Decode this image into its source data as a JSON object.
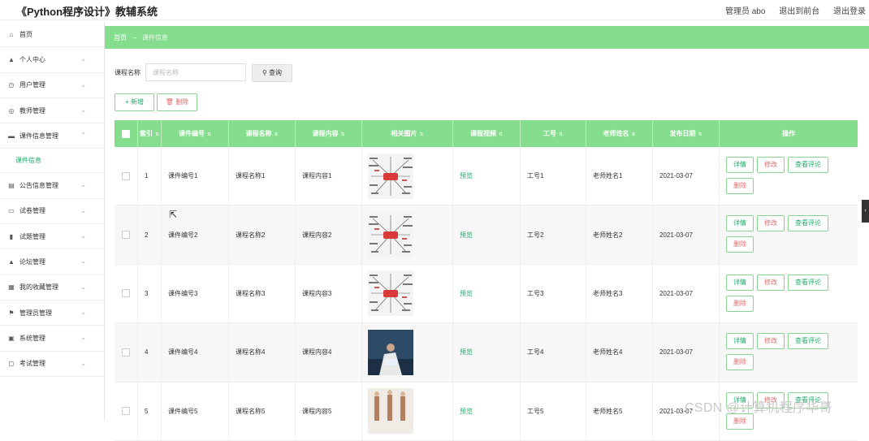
{
  "app": {
    "title": "《Python程序设计》教辅系统",
    "user_label": "管理员 abo",
    "front_link": "退出到前台",
    "logout_link": "退出登录"
  },
  "sidebar": {
    "items": [
      {
        "label": "首页",
        "icon": "home-icon"
      },
      {
        "label": "个人中心",
        "icon": "user-icon"
      },
      {
        "label": "用户管理",
        "icon": "clock-icon"
      },
      {
        "label": "教师管理",
        "icon": "circle-icon"
      },
      {
        "label": "课件信息管理",
        "icon": "folder-icon",
        "expanded": true,
        "sub": "课件信息"
      },
      {
        "label": "公告信息管理",
        "icon": "board-icon"
      },
      {
        "label": "试卷管理",
        "icon": "paper-icon"
      },
      {
        "label": "试题管理",
        "icon": "bar-chart-icon"
      },
      {
        "label": "论坛管理",
        "icon": "forum-icon"
      },
      {
        "label": "我的收藏管理",
        "icon": "grid-icon"
      },
      {
        "label": "管理员管理",
        "icon": "flag-icon"
      },
      {
        "label": "系统管理",
        "icon": "system-icon"
      },
      {
        "label": "考试管理",
        "icon": "exam-icon"
      }
    ]
  },
  "breadcrumb": {
    "home": "首页",
    "arrow": "→",
    "current": "课件信息"
  },
  "search": {
    "label": "课程名称",
    "placeholder": "课程名称",
    "button": "查询"
  },
  "toolbar": {
    "add": "新增",
    "delete": "删除"
  },
  "table": {
    "columns": [
      "索引",
      "课件编号",
      "课程名称",
      "课程内容",
      "相关图片",
      "课程视频",
      "工号",
      "老师姓名",
      "发布日期",
      "操作"
    ],
    "rows": [
      {
        "idx": "1",
        "code": "课件编号1",
        "name": "课程名称1",
        "content": "课程内容1",
        "video": "预览",
        "job": "工号1",
        "teacher": "老师姓名1",
        "date": "2021-03-07",
        "img": "mindmap"
      },
      {
        "idx": "2",
        "code": "课件编号2",
        "name": "课程名称2",
        "content": "课程内容2",
        "video": "预览",
        "job": "工号2",
        "teacher": "老师姓名2",
        "date": "2021-03-07",
        "img": "mindmap"
      },
      {
        "idx": "3",
        "code": "课件编号3",
        "name": "课程名称3",
        "content": "课程内容3",
        "video": "预览",
        "job": "工号3",
        "teacher": "老师姓名3",
        "date": "2021-03-07",
        "img": "mindmap"
      },
      {
        "idx": "4",
        "code": "课件编号4",
        "name": "课程名称4",
        "content": "课程内容4",
        "video": "预览",
        "job": "工号4",
        "teacher": "老师姓名4",
        "date": "2021-03-07",
        "img": "business"
      },
      {
        "idx": "5",
        "code": "课件编号5",
        "name": "课程名称5",
        "content": "课程内容5",
        "video": "预览",
        "job": "工号5",
        "teacher": "老师姓名5",
        "date": "2021-03-07",
        "img": "people"
      }
    ],
    "actions": {
      "detail": "详情",
      "edit": "修改",
      "comment": "查看评论",
      "delete": "删除"
    }
  },
  "watermark": "CSDN @计算机程序华哥",
  "colors": {
    "accent": "#85de8e",
    "link": "#22a86a",
    "danger": "#e06b6b"
  }
}
